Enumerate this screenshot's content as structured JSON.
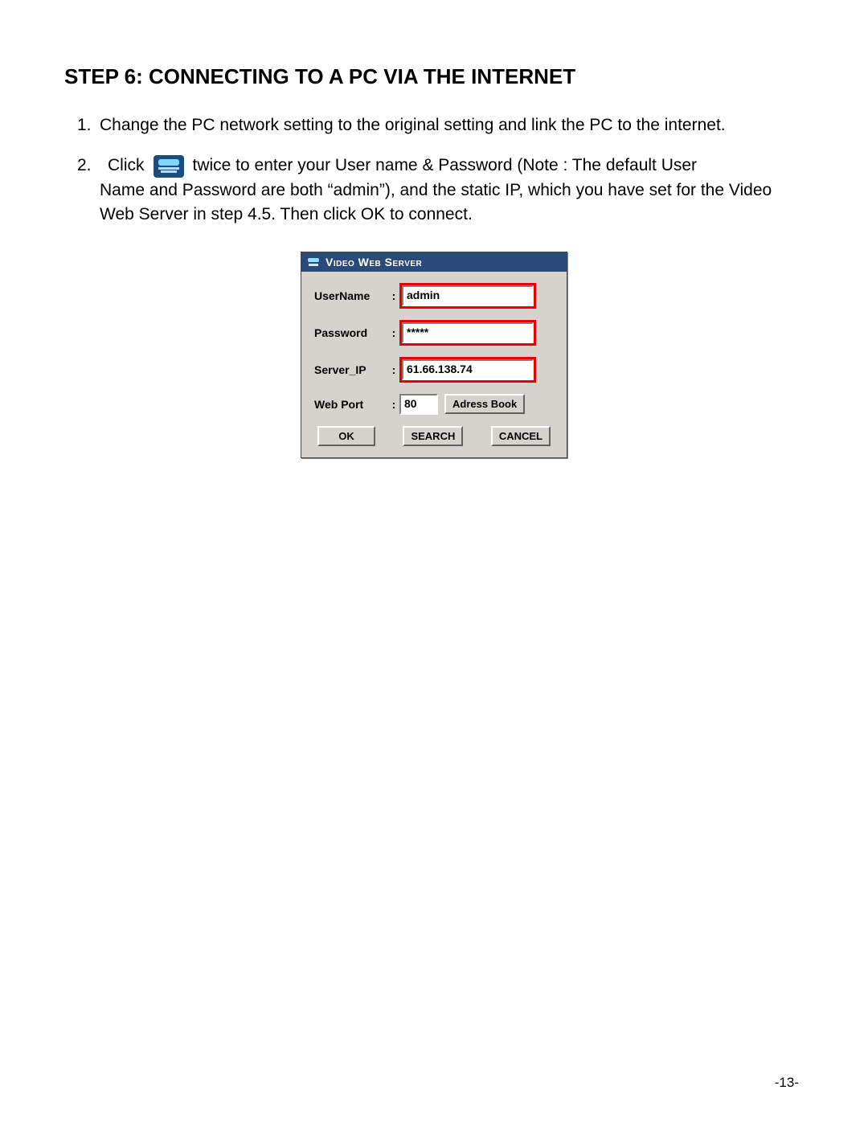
{
  "heading": "STEP 6:  CONNECTING TO A PC VIA THE INTERNET",
  "item1": {
    "num": "1.",
    "text": "Change the PC network setting to the original setting and link the PC to the internet."
  },
  "item2": {
    "num": "2.",
    "before_icon": "Click",
    "after_icon": "twice to enter your User name & Password (Note : The default  User",
    "line2": "Name and Password are both “admin”), and the static IP, which you have set for the Video Web Server in step 4.5. Then click OK to connect."
  },
  "dialog": {
    "title": "Video Web Server",
    "labels": {
      "username": "UserName",
      "password": "Password",
      "serverip": "Server_IP",
      "webport": "Web Port"
    },
    "colon": ":",
    "values": {
      "username": "admin",
      "password": "*****",
      "serverip": "61.66.138.74",
      "webport": "80"
    },
    "buttons": {
      "address_book": "Adress Book",
      "ok": "OK",
      "search": "SEARCH",
      "cancel": "CANCEL"
    }
  },
  "page_number": "-13-"
}
